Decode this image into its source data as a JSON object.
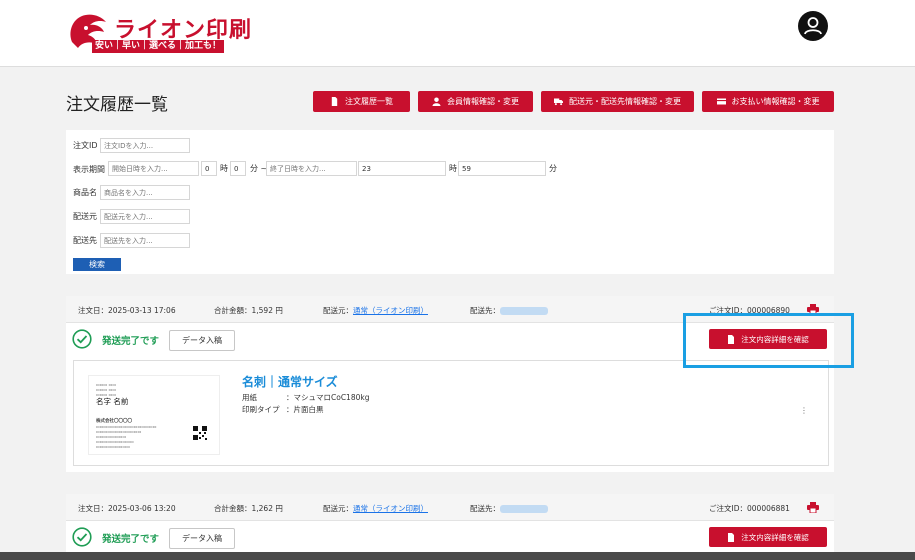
{
  "brand": {
    "name": "ライオン印刷",
    "tagline": "安い｜早い｜選べる｜加工も！",
    "primary_color": "#c8102e",
    "link_color": "#1a73e8",
    "success_color": "#1f9d55"
  },
  "header": {
    "account_icon": "user-icon"
  },
  "page": {
    "title": "注文履歴一覧"
  },
  "nav": {
    "order_history": "注文履歴一覧",
    "member_info": "会員情報確認・変更",
    "shipping_info": "配送元・配送先情報確認・変更",
    "payment_info": "お支払い情報確認・変更"
  },
  "search": {
    "order_id": {
      "label": "注文ID",
      "placeholder": "注文IDを入力..."
    },
    "period": {
      "label": "表示期間",
      "start_placeholder": "開始日時を入力...",
      "start_hour": "0",
      "hour_unit": "時",
      "start_minute": "0",
      "minute_tilde": "分 ~",
      "end_placeholder": "終了日時を入力...",
      "end_hour": "23",
      "end_minute": "59",
      "minute_unit": "分"
    },
    "product_name": {
      "label": "商品名",
      "placeholder": "商品名を入力..."
    },
    "ship_from": {
      "label": "配送元",
      "placeholder": "配送元を入力..."
    },
    "ship_to": {
      "label": "配送先",
      "placeholder": "配送先を入力..."
    },
    "submit_label": "検索"
  },
  "orders": [
    {
      "date_label": "注文日：",
      "date": "2025-03-13 17:06",
      "total_label": "合計金額：",
      "total": "1,592 円",
      "from_label": "配送元：",
      "from": "通常（ライオン印刷）",
      "to_label": "配送先：",
      "order_id_label": "ご注文ID：",
      "order_id": "000006890",
      "status": "発送完了です",
      "data_button": "データ入稿",
      "detail_button": "注文内容詳細を確認",
      "item": {
        "title": "名刺｜通常サイズ",
        "paper_label": "用紙",
        "paper": "：マシュマロCoC180kg",
        "print_label": "印刷タイプ",
        "print": "：片面白黒",
        "preview": {
          "name": "名字 名前",
          "company": "株式会社〇〇〇〇"
        }
      }
    },
    {
      "date_label": "注文日：",
      "date": "2025-03-06 13:20",
      "total_label": "合計金額：",
      "total": "1,262 円",
      "from_label": "配送元：",
      "from": "通常（ライオン印刷）",
      "to_label": "配送先：",
      "order_id_label": "ご注文ID：",
      "order_id": "000006881",
      "status": "発送完了です",
      "data_button": "データ入稿",
      "detail_button": "注文内容詳細を確認"
    }
  ]
}
